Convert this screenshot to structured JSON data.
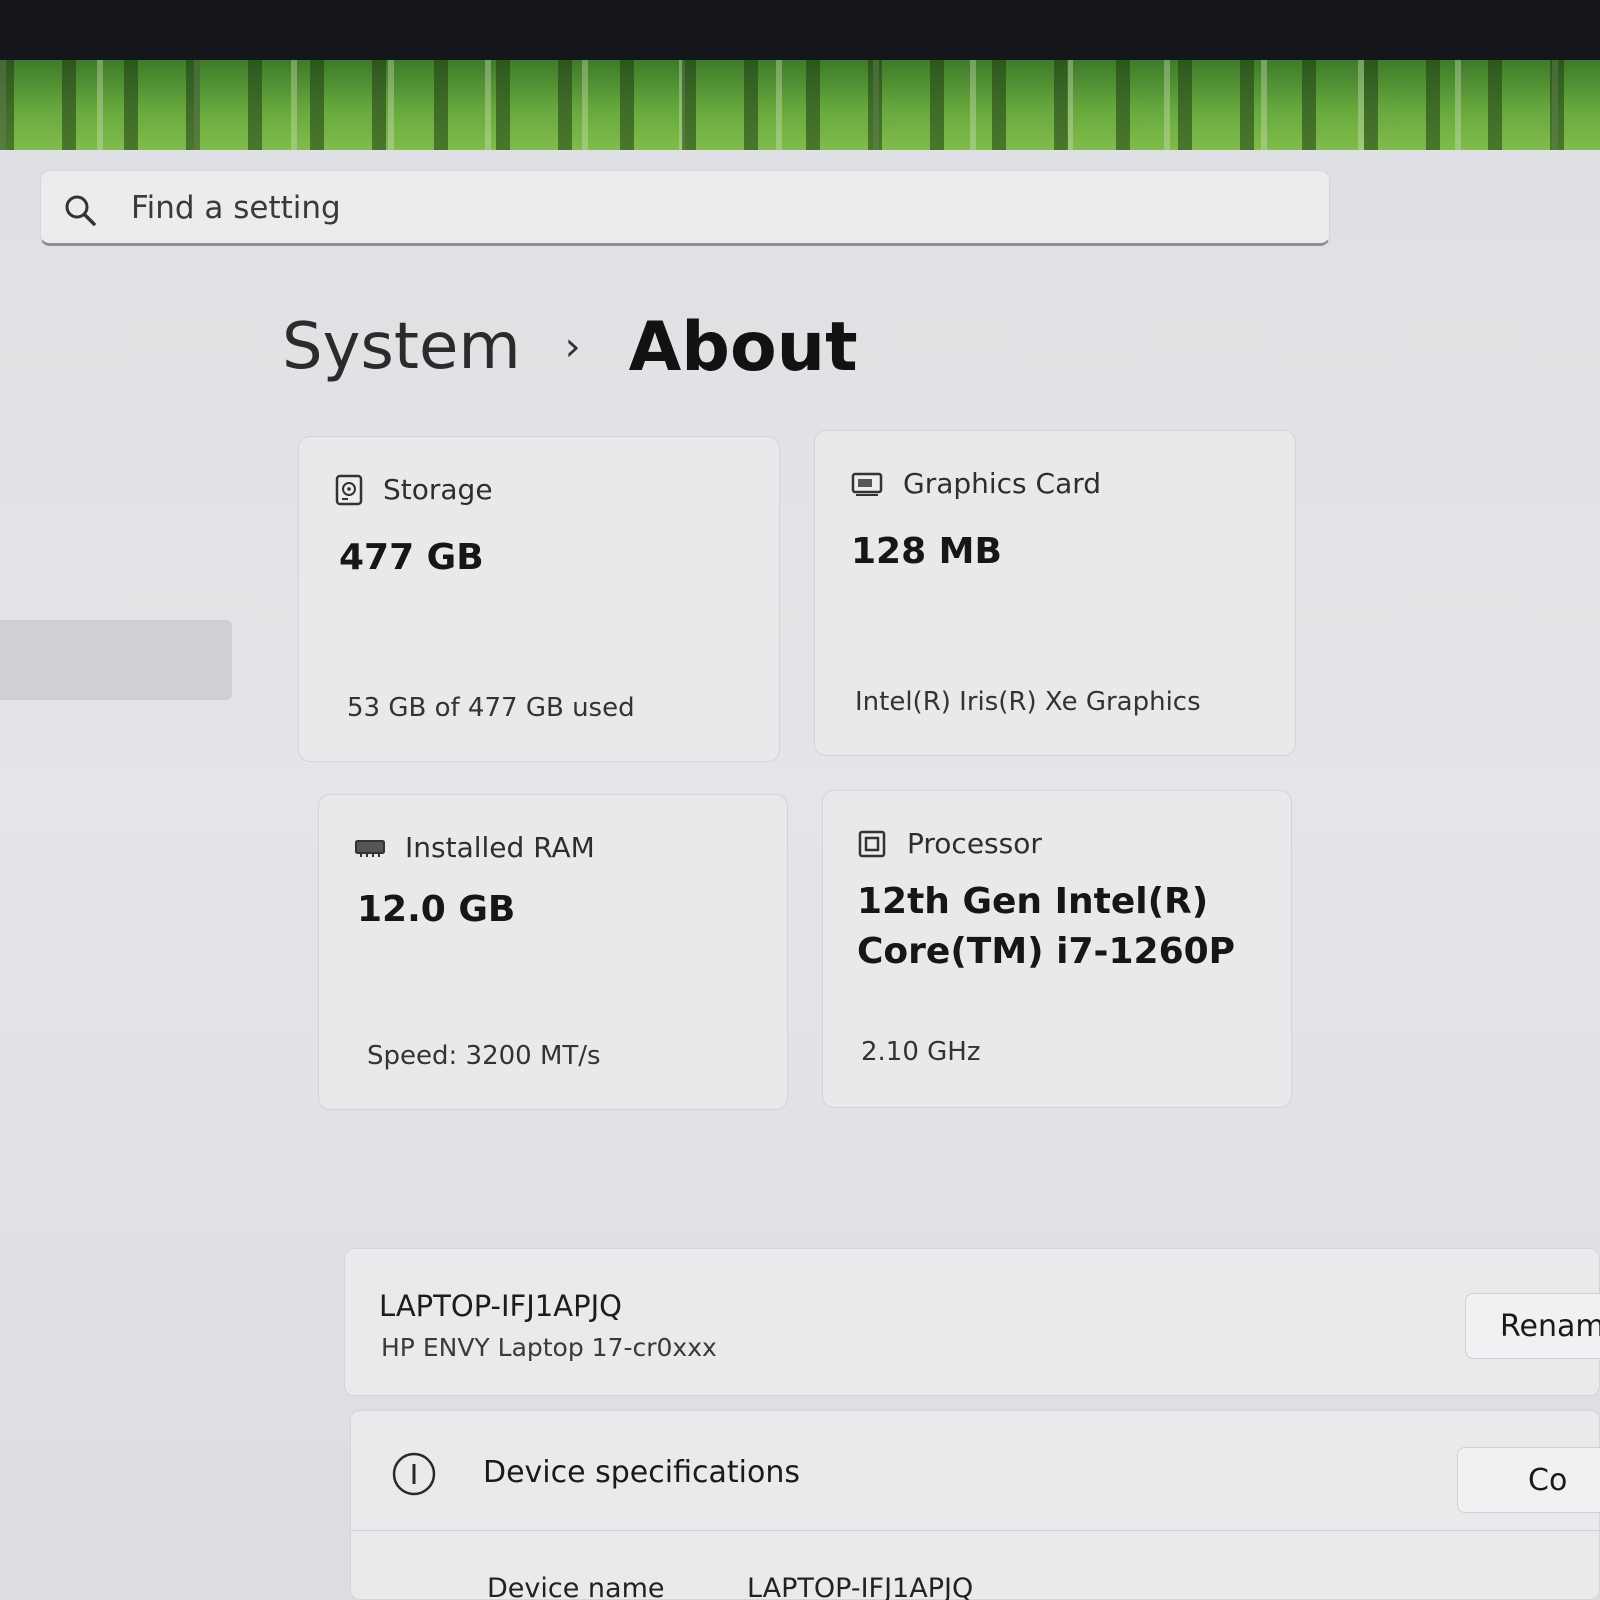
{
  "search": {
    "placeholder": "Find a setting"
  },
  "breadcrumb": {
    "parent": "System",
    "separator": "›",
    "current": "About"
  },
  "cards": {
    "storage": {
      "label": "Storage",
      "value": "477 GB",
      "detail": "53 GB of 477 GB used"
    },
    "graphics": {
      "label": "Graphics Card",
      "value": "128 MB",
      "detail": "Intel(R) Iris(R) Xe Graphics"
    },
    "ram": {
      "label": "Installed RAM",
      "value": "12.0 GB",
      "detail": "Speed: 3200 MT/s"
    },
    "processor": {
      "label": "Processor",
      "value_line1": "12th Gen Intel(R)",
      "value_line2": "Core(TM) i7-1260P",
      "detail": "2.10 GHz"
    }
  },
  "device": {
    "name": "LAPTOP-IFJ1APJQ",
    "model": "HP ENVY Laptop 17-cr0xxx",
    "rename_label": "Renam"
  },
  "specs": {
    "title": "Device specifications",
    "copy_label": "Co",
    "device_name_label": "Device name",
    "device_name_value": "LAPTOP-IFJ1APJQ"
  },
  "icons": [
    "search-icon",
    "storage-drive-icon",
    "graphics-card-icon",
    "ram-module-icon",
    "processor-chip-icon",
    "info-icon"
  ]
}
